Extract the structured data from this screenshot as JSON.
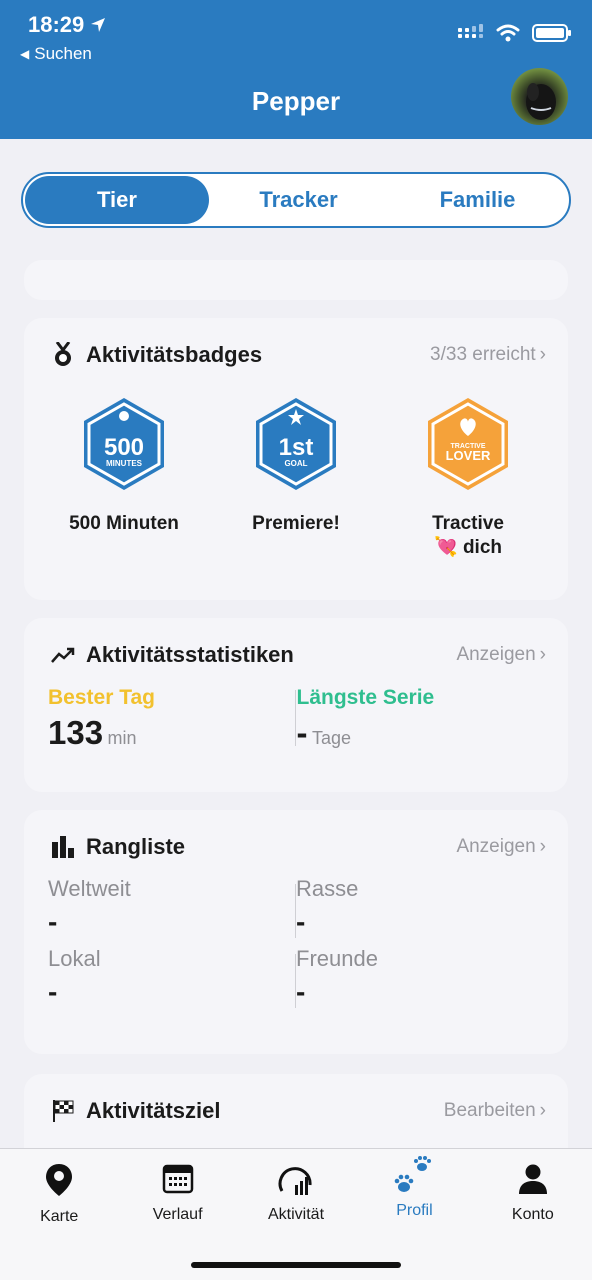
{
  "status": {
    "time": "18:29",
    "back_label": "Suchen"
  },
  "header": {
    "title": "Pepper"
  },
  "tabs": [
    {
      "label": "Tier",
      "active": true
    },
    {
      "label": "Tracker",
      "active": false
    },
    {
      "label": "Familie",
      "active": false
    }
  ],
  "badges_card": {
    "title": "Aktivitätsbadges",
    "link": "3/33 erreicht",
    "items": [
      {
        "label": "500 Minuten",
        "big": "500",
        "small": "MINUTES",
        "color": "#2a7bc0"
      },
      {
        "label": "Premiere!",
        "big": "1st",
        "small": "GOAL",
        "color": "#2a7bc0"
      },
      {
        "label_line1": "Tractive",
        "label_emoji": "💘",
        "label_line2": "dich",
        "top": "TRACTIVE",
        "bottom": "LOVER",
        "color": "#f5a23a"
      }
    ]
  },
  "stats_card": {
    "title": "Aktivitätsstatistiken",
    "link": "Anzeigen",
    "best_day": {
      "label": "Bester Tag",
      "value": "133",
      "unit": "min",
      "color": "#f2c12e"
    },
    "longest_streak": {
      "label": "Längste Serie",
      "value": "-",
      "unit": "Tage",
      "color": "#2fbe8f"
    }
  },
  "leaderboard_card": {
    "title": "Rangliste",
    "link": "Anzeigen",
    "worldwide": {
      "label": "Weltweit",
      "value": "-"
    },
    "breed": {
      "label": "Rasse",
      "value": "-"
    },
    "local": {
      "label": "Lokal",
      "value": "-"
    },
    "friends": {
      "label": "Freunde",
      "value": "-"
    }
  },
  "goal_card": {
    "title": "Aktivitätsziel",
    "link": "Bearbeiten"
  },
  "bottom_nav": [
    {
      "label": "Karte",
      "icon": "map-pin-icon",
      "active": false
    },
    {
      "label": "Verlauf",
      "icon": "calendar-icon",
      "active": false
    },
    {
      "label": "Aktivität",
      "icon": "activity-gauge-icon",
      "active": false
    },
    {
      "label": "Profil",
      "icon": "paw-icon",
      "active": true
    },
    {
      "label": "Konto",
      "icon": "person-icon",
      "active": false
    }
  ],
  "colors": {
    "brand": "#2a7bc0",
    "background": "#f0f0f5"
  }
}
